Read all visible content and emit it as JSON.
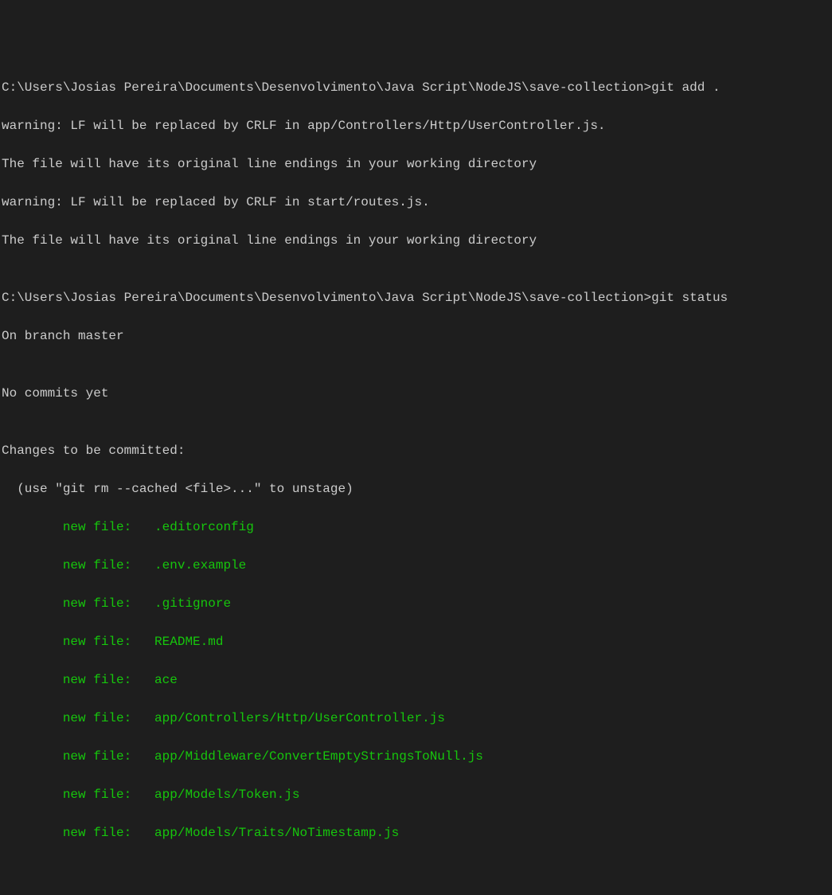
{
  "terminal": {
    "line1_prompt": "C:\\Users\\Josias Pereira\\Documents\\Desenvolvimento\\Java Script\\NodeJS\\save-collection>",
    "line1_cmd": "git add .",
    "line2": "warning: LF will be replaced by CRLF in app/Controllers/Http/UserController.js.",
    "line3": "The file will have its original line endings in your working directory",
    "line4": "warning: LF will be replaced by CRLF in start/routes.js.",
    "line5": "The file will have its original line endings in your working directory",
    "line6": "",
    "line7_prompt": "C:\\Users\\Josias Pereira\\Documents\\Desenvolvimento\\Java Script\\NodeJS\\save-collection>",
    "line7_cmd": "git status",
    "line8": "On branch master",
    "line9": "",
    "line10": "No commits yet",
    "line11": "",
    "line12": "Changes to be committed:",
    "line13": "  (use \"git rm --cached <file>...\" to unstage)",
    "file1": "        new file:   .editorconfig",
    "file2": "        new file:   .env.example",
    "file3": "        new file:   .gitignore",
    "file4": "        new file:   README.md",
    "file5": "        new file:   ace",
    "file6": "        new file:   app/Controllers/Http/UserController.js",
    "file7": "        new file:   app/Middleware/ConvertEmptyStringsToNull.js",
    "file8": "        new file:   app/Models/Token.js",
    "file9": "        new file:   app/Models/Traits/NoTimestamp.js"
  }
}
